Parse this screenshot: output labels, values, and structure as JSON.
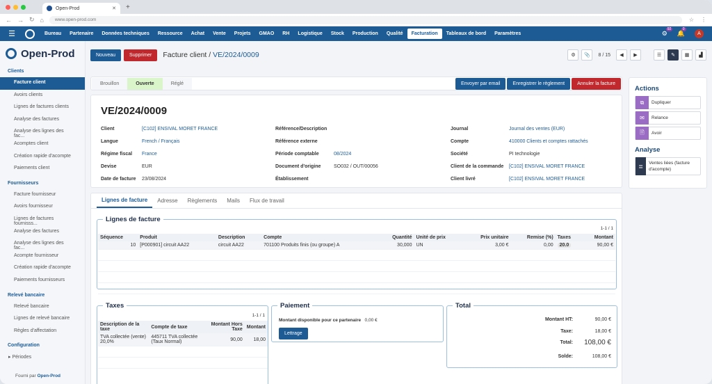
{
  "browser": {
    "tab_title": "Open-Prod",
    "url": "www.open-prod.com"
  },
  "topnav": {
    "items": [
      "Bureau",
      "Partenaire",
      "Données techniques",
      "Ressource",
      "Achat",
      "Vente",
      "Projets",
      "GMAO",
      "RH",
      "Logistique",
      "Stock",
      "Production",
      "Qualité",
      "Facturation",
      "Tableaux de bord",
      "Paramètres"
    ],
    "active": "Facturation",
    "badge_settings": "92",
    "badge_notif": "0",
    "avatar": "A"
  },
  "brand": "Open-Prod",
  "sidebar": {
    "clients": {
      "title": "Clients",
      "items": [
        "Facture client",
        "Avoirs clients",
        "Lignes de factures clients",
        "Analyse des factures",
        "Analyse des lignes des fac...",
        "Acomptes client",
        "Création rapide d'acompte",
        "Paiements client"
      ]
    },
    "fournisseurs": {
      "title": "Fournisseurs",
      "items": [
        "Facture fournisseur",
        "Avoirs fournisseur",
        "Lignes de factures fournisss...",
        "Analyse des factures",
        "Analyse des lignes des fac...",
        "Acompte fournisseur",
        "Création rapide d'acompte",
        "Paiements fournisseurs"
      ]
    },
    "releve": {
      "title": "Relevé bancaire",
      "items": [
        "Relevé bancaire",
        "Lignes de relevé bancaire",
        "Règles d'affectation"
      ]
    },
    "config": {
      "title": "Configuration",
      "items": [
        "Périodes"
      ]
    },
    "footer_prefix": "Fourni par",
    "footer_brand": "Open-Prod"
  },
  "toolbar": {
    "new": "Nouveau",
    "delete": "Supprimer",
    "crumb_parent": "Facture client",
    "crumb_sep": "/",
    "crumb_current": "VE/2024/0009",
    "pager": "8 / 15"
  },
  "status": {
    "steps": [
      "Brouillon",
      "Ouverte",
      "Réglé"
    ],
    "active": "Ouverte"
  },
  "status_buttons": {
    "email": "Envoyer par email",
    "payment": "Enregistrer le règlement",
    "cancel": "Annuler la facture"
  },
  "invoice": {
    "title": "VE/2024/0009",
    "col1": [
      [
        "Client",
        "[C102] ENSIVAL MORET FRANCE",
        true
      ],
      [
        "Langue",
        "French / Français",
        true
      ],
      [
        "Régime fiscal",
        "France",
        true
      ],
      [
        "Devise",
        "EUR",
        false
      ],
      [
        "Date de facture",
        "23/08/2024",
        false
      ]
    ],
    "col2": [
      [
        "Référence/Description",
        "",
        false
      ],
      [
        "Référence externe",
        "",
        false
      ],
      [
        "Période comptable",
        "08/2024",
        true
      ],
      [
        "Document d'origine",
        "SO032 / OUT/00056",
        false
      ],
      [
        "Établissement",
        "",
        false
      ]
    ],
    "col3": [
      [
        "Journal",
        "Journal des ventes (EUR)",
        true
      ],
      [
        "Compte",
        "410000 Clients et comptes rattachés",
        true
      ],
      [
        "Société",
        "PI technologie",
        false
      ],
      [
        "Client de la commande",
        "[C102] ENSIVAL MORET FRANCE",
        true
      ],
      [
        "Client livré",
        "[C102] ENSIVAL MORET FRANCE",
        true
      ]
    ]
  },
  "tabs": [
    "Lignes de facture",
    "Adresse",
    "Règlements",
    "Mails",
    "Flux de travail"
  ],
  "lines": {
    "legend": "Lignes de facture",
    "count": "1-1 / 1",
    "headers": [
      "Séquence",
      "Produit",
      "Description",
      "Compte",
      "Quantité",
      "Unité de prix",
      "Prix unitaire",
      "Remise (%)",
      "Taxes",
      "Montant"
    ],
    "rows": [
      [
        "10",
        "[P000901] circuit AA22",
        "circuit AA22",
        "701100 Produits finis (ou groupe) A",
        "30,000",
        "UN",
        "3,00 €",
        "0,00",
        "20.0",
        "90,00 €"
      ]
    ]
  },
  "taxes": {
    "legend": "Taxes",
    "count": "1-1 / 1",
    "headers": [
      "Description de la taxe",
      "Compte de taxe",
      "Montant Hors Taxe",
      "Montant"
    ],
    "rows": [
      [
        "TVA collectée (vente) 20,0%",
        "445711 TVA collectée (Taux Normal)",
        "90,00",
        "18,00"
      ]
    ]
  },
  "paiement": {
    "legend": "Paiement",
    "label": "Montant disponible pour ce partenaire",
    "value": "0,00 €",
    "button": "Lettrage"
  },
  "total": {
    "legend": "Total",
    "rows": [
      [
        "Montant HT:",
        "90,00 €"
      ],
      [
        "Taxe:",
        "18,00 €"
      ],
      [
        "Total:",
        "108,00 €"
      ],
      [
        "Solde:",
        "108,00 €"
      ]
    ]
  },
  "actions": {
    "title": "Actions",
    "items": [
      "Dupliquer",
      "Relance",
      "Avoir"
    ],
    "analyse_title": "Analyse",
    "analyse_item": "Ventes liées (facture d'acompte)"
  }
}
